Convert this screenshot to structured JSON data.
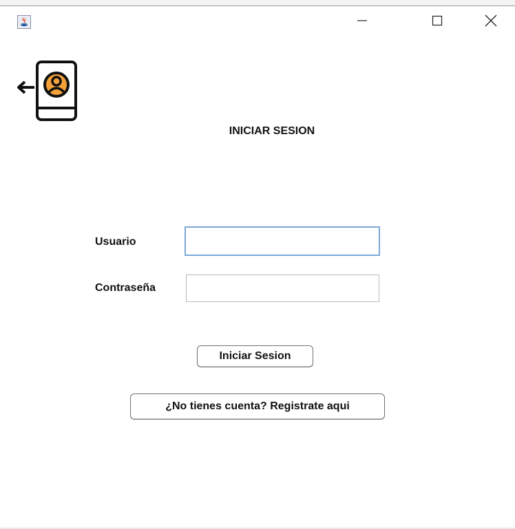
{
  "window": {
    "app_icon": "java-coffee-icon",
    "controls": [
      "minimize-icon",
      "maximize-icon",
      "close-icon"
    ]
  },
  "logo": {
    "icon": "back-logout-user-icon",
    "accent_color": "#f5a13a"
  },
  "page": {
    "title": "INICIAR SESION"
  },
  "form": {
    "username_label": "Usuario",
    "username_value": "",
    "password_label": "Contraseña",
    "password_value": ""
  },
  "buttons": {
    "login_label": "Iniciar Sesion",
    "register_label": "¿No tienes cuenta? Registrate aqui"
  }
}
